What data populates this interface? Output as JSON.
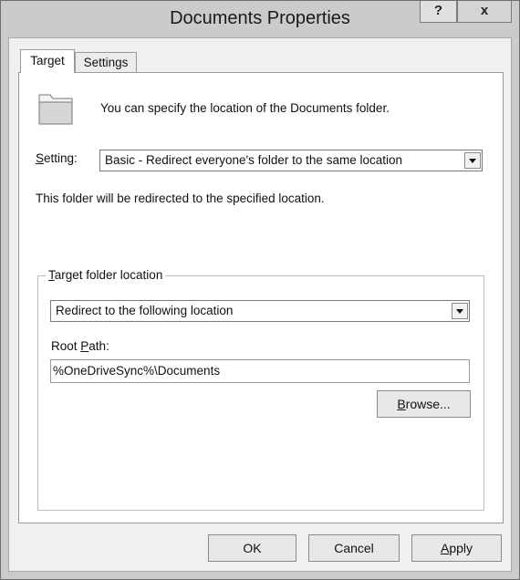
{
  "window": {
    "title": "Documents Properties",
    "help_label": "?",
    "close_label": "x"
  },
  "tabs": [
    {
      "label": "Target",
      "selected": true
    },
    {
      "label": "Settings",
      "selected": false
    }
  ],
  "target": {
    "description": "You can specify the location of the Documents folder.",
    "setting_label_first": "S",
    "setting_label_rest": "etting:",
    "setting_value": "Basic - Redirect everyone's folder to the same location",
    "redirect_note": "This folder will be redirected to the specified location.",
    "group": {
      "legend_first": "T",
      "legend_rest": "arget folder location",
      "location_value": "Redirect to the following location",
      "root_path_label_prefix": "Root ",
      "root_path_label_underlined": "P",
      "root_path_label_suffix": "ath:",
      "root_path_value": "%OneDriveSync%\\Documents",
      "browse_underlined": "B",
      "browse_rest": "rowse..."
    }
  },
  "buttons": {
    "ok": "OK",
    "cancel": "Cancel",
    "apply_underlined": "A",
    "apply_rest": "pply"
  },
  "icons": {
    "folder": "folder-icon",
    "dropdown_arrow": "chevron-down-icon"
  }
}
